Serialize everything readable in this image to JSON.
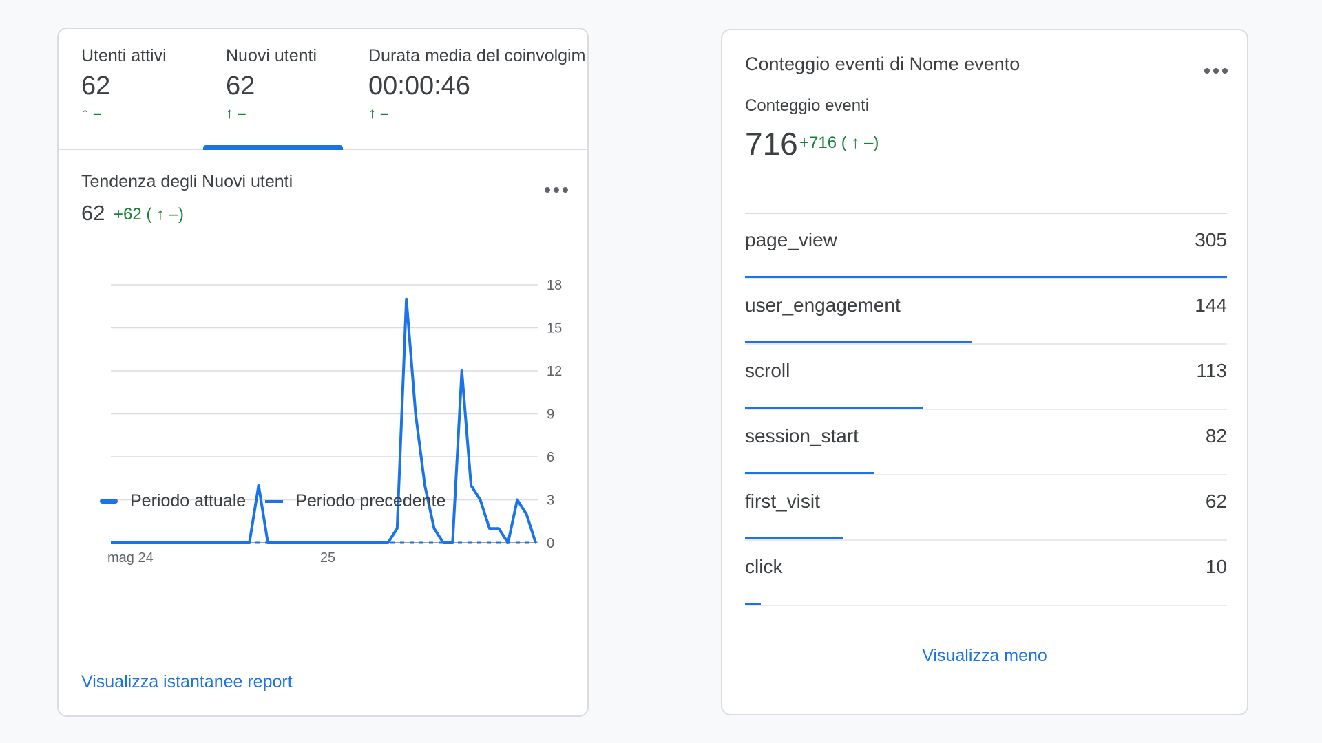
{
  "users_card": {
    "tabs": [
      {
        "label": "Utenti attivi",
        "value": "62",
        "delta": "↑ –"
      },
      {
        "label": "Nuovi utenti",
        "value": "62",
        "delta": "↑ –"
      },
      {
        "label": "Durata media del coinvolgim",
        "value": "00:00:46",
        "delta": "↑ –"
      }
    ],
    "active_tab": "Nuovi utenti",
    "trend_title": "Tendenza degli Nuovi utenti",
    "trend_value": "62",
    "trend_delta": "+62 ( ↑ –)",
    "more_icon": "more-horiz-icon",
    "link": "Visualizza istantanee report"
  },
  "chart_data": {
    "type": "line",
    "x_tick_labels": [
      "mag 24",
      "25"
    ],
    "y_ticks": [
      0,
      3,
      6,
      9,
      12,
      15,
      18
    ],
    "ylim": [
      0,
      18
    ],
    "grid": true,
    "legend_position": "bottom-left",
    "series": [
      {
        "name": "Periodo attuale",
        "style": "solid",
        "color": "#1a73e8",
        "values": [
          0,
          0,
          0,
          0,
          0,
          0,
          0,
          0,
          0,
          0,
          0,
          0,
          0,
          0,
          0,
          0,
          4,
          0,
          0,
          0,
          0,
          0,
          0,
          0,
          0,
          0,
          0,
          0,
          0,
          0,
          0,
          1,
          17,
          9,
          4,
          1,
          0,
          0,
          12,
          4,
          3,
          1,
          1,
          0,
          3,
          2,
          0
        ]
      },
      {
        "name": "Periodo precedente",
        "style": "dashed",
        "color": "#1a73e8",
        "values": [
          0,
          0,
          0,
          0,
          0,
          0,
          0,
          0,
          0,
          0,
          0,
          0,
          0,
          0,
          0,
          0,
          0,
          0,
          0,
          0,
          0,
          0,
          0,
          0,
          0,
          0,
          0,
          0,
          0,
          0,
          0,
          0,
          0,
          0,
          0,
          0,
          0,
          0,
          0,
          0,
          0,
          0,
          0,
          0,
          0,
          0,
          0
        ]
      }
    ]
  },
  "events_card": {
    "title": "Conteggio eventi di Nome evento",
    "subtitle": "Conteggio eventi",
    "total": "716",
    "delta": "+716 ( ↑ –)",
    "more_icon": "more-horiz-icon",
    "rows": [
      {
        "name": "page_view",
        "count": "305"
      },
      {
        "name": "user_engagement",
        "count": "144"
      },
      {
        "name": "scroll",
        "count": "113"
      },
      {
        "name": "session_start",
        "count": "82"
      },
      {
        "name": "first_visit",
        "count": "62"
      },
      {
        "name": "click",
        "count": "10"
      }
    ],
    "link": "Visualizza meno"
  },
  "colors": {
    "accent": "#1a73e8",
    "positive": "#188038",
    "border": "#dadce0",
    "text": "#3c4043"
  }
}
